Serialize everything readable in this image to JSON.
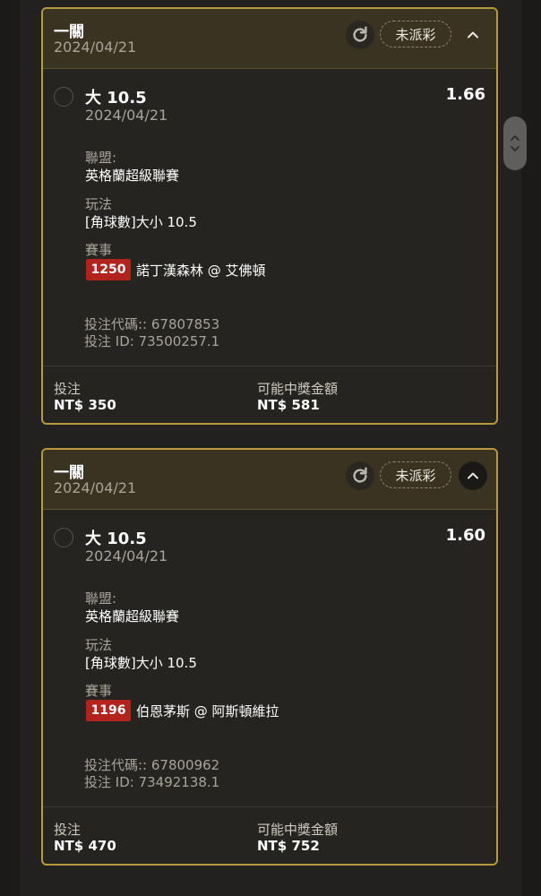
{
  "bets": [
    {
      "title": "一關",
      "date": "2024/04/21",
      "status": "未派彩",
      "selection": "大 10.5",
      "odds": "1.66",
      "selection_date": "2024/04/21",
      "league_label": "聯盟:",
      "league": "英格蘭超級聯賽",
      "market_label": "玩法",
      "market": "[角球數]大小 10.5",
      "event_label": "賽事",
      "match_code": "1250",
      "match": "諾丁漢森林 @ 艾佛頓",
      "bet_code": "投注代碼:: 67807853",
      "bet_id": "投注 ID: 73500257.1",
      "stake_label": "投注",
      "stake": "NT$ 350",
      "payout_label": "可能中獎金額",
      "payout": "NT$ 581"
    },
    {
      "title": "一關",
      "date": "2024/04/21",
      "status": "未派彩",
      "selection": "大 10.5",
      "odds": "1.60",
      "selection_date": "2024/04/21",
      "league_label": "聯盟:",
      "league": "英格蘭超級聯賽",
      "market_label": "玩法",
      "market": "[角球數]大小 10.5",
      "event_label": "賽事",
      "match_code": "1196",
      "match": "伯恩茅斯 @ 阿斯頓維拉",
      "bet_code": "投注代碼:: 67800962",
      "bet_id": "投注 ID: 73492138.1",
      "stake_label": "投注",
      "stake": "NT$ 470",
      "payout_label": "可能中獎金額",
      "payout": "NT$ 752"
    }
  ],
  "icons": {
    "refresh": "refresh-icon",
    "collapse": "chevron-up-icon",
    "scroll_up": "chevron-up-icon",
    "scroll_down": "chevron-down-icon"
  },
  "colors": {
    "accent_border": "#b79a3e",
    "header_bg": "#3a3322",
    "match_badge": "#b3231d"
  }
}
